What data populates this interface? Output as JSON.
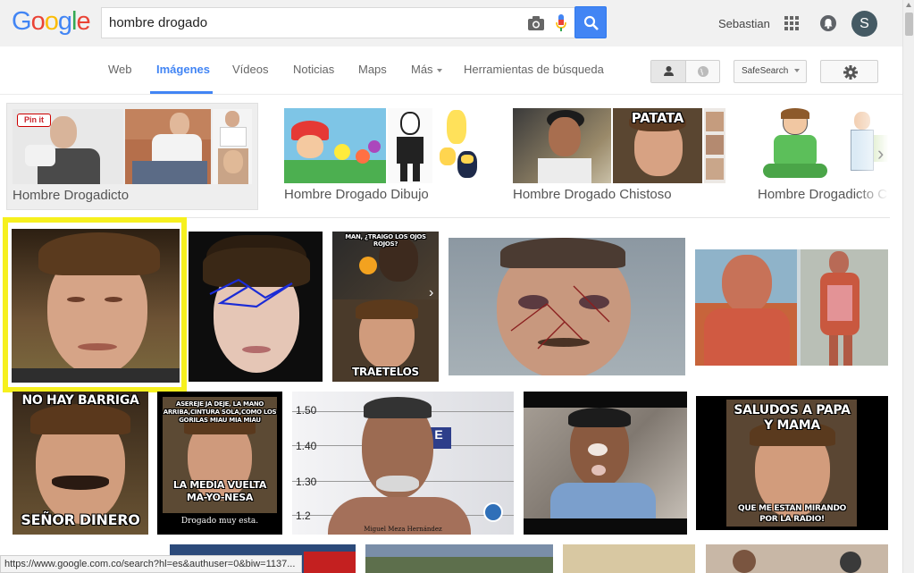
{
  "header": {
    "logo_letters": [
      {
        "ch": "G",
        "color": "#4285f4"
      },
      {
        "ch": "o",
        "color": "#ea4335"
      },
      {
        "ch": "o",
        "color": "#fbbc05"
      },
      {
        "ch": "g",
        "color": "#4285f4"
      },
      {
        "ch": "l",
        "color": "#34a853"
      },
      {
        "ch": "e",
        "color": "#ea4335"
      }
    ],
    "search_value": "hombre drogado",
    "user_name": "Sebastian",
    "avatar_letter": "S",
    "accent": "#4285f4"
  },
  "tabs": {
    "web": "Web",
    "images": "Imágenes",
    "videos": "Vídeos",
    "news": "Noticias",
    "maps": "Maps",
    "more": "Más",
    "tools": "Herramientas de búsqueda",
    "safesearch": "SafeSearch"
  },
  "related": {
    "items": [
      {
        "label": "Hombre Drogadicto",
        "badge": "Pin it"
      },
      {
        "label": "Hombre Drogado Dibujo"
      },
      {
        "label": "Hombre Drogado Chistoso",
        "overlay": "PATATA"
      },
      {
        "label": "Hombre Drogadicto C"
      }
    ]
  },
  "grid": {
    "row1_meme_top": "MAN, ¿TRAIGO LOS OJOS ROJOS?",
    "row1_meme_bottom": "TRAETELOS",
    "row2": {
      "meme1_top": "NO HAY BARRIGA",
      "meme1_bottom": "SEÑOR DINERO",
      "meme2_top": "ASEREJE JA DEJE, LA MANO ARRIBA,CINTURA SOLA,COMO LOS GORILAS MIAU MIA MIAU",
      "meme2_bottom": "LA MEDIA VUELTA MA-YO-NESA",
      "meme2_caption": "Drogado muy esta.",
      "mugshot_ticks": [
        "1.50",
        "1.40",
        "1.30",
        "1.2"
      ],
      "mugshot_caption": "Miguel Meza Hernández",
      "meme3_top": "SALUDOS A PAPA Y MAMA",
      "meme3_bottom": "QUE ME ESTAN MIRANDO POR LA RADIO!"
    }
  },
  "status": {
    "url": "https://www.google.com.co/search?hl=es&authuser=0&biw=1137..."
  }
}
